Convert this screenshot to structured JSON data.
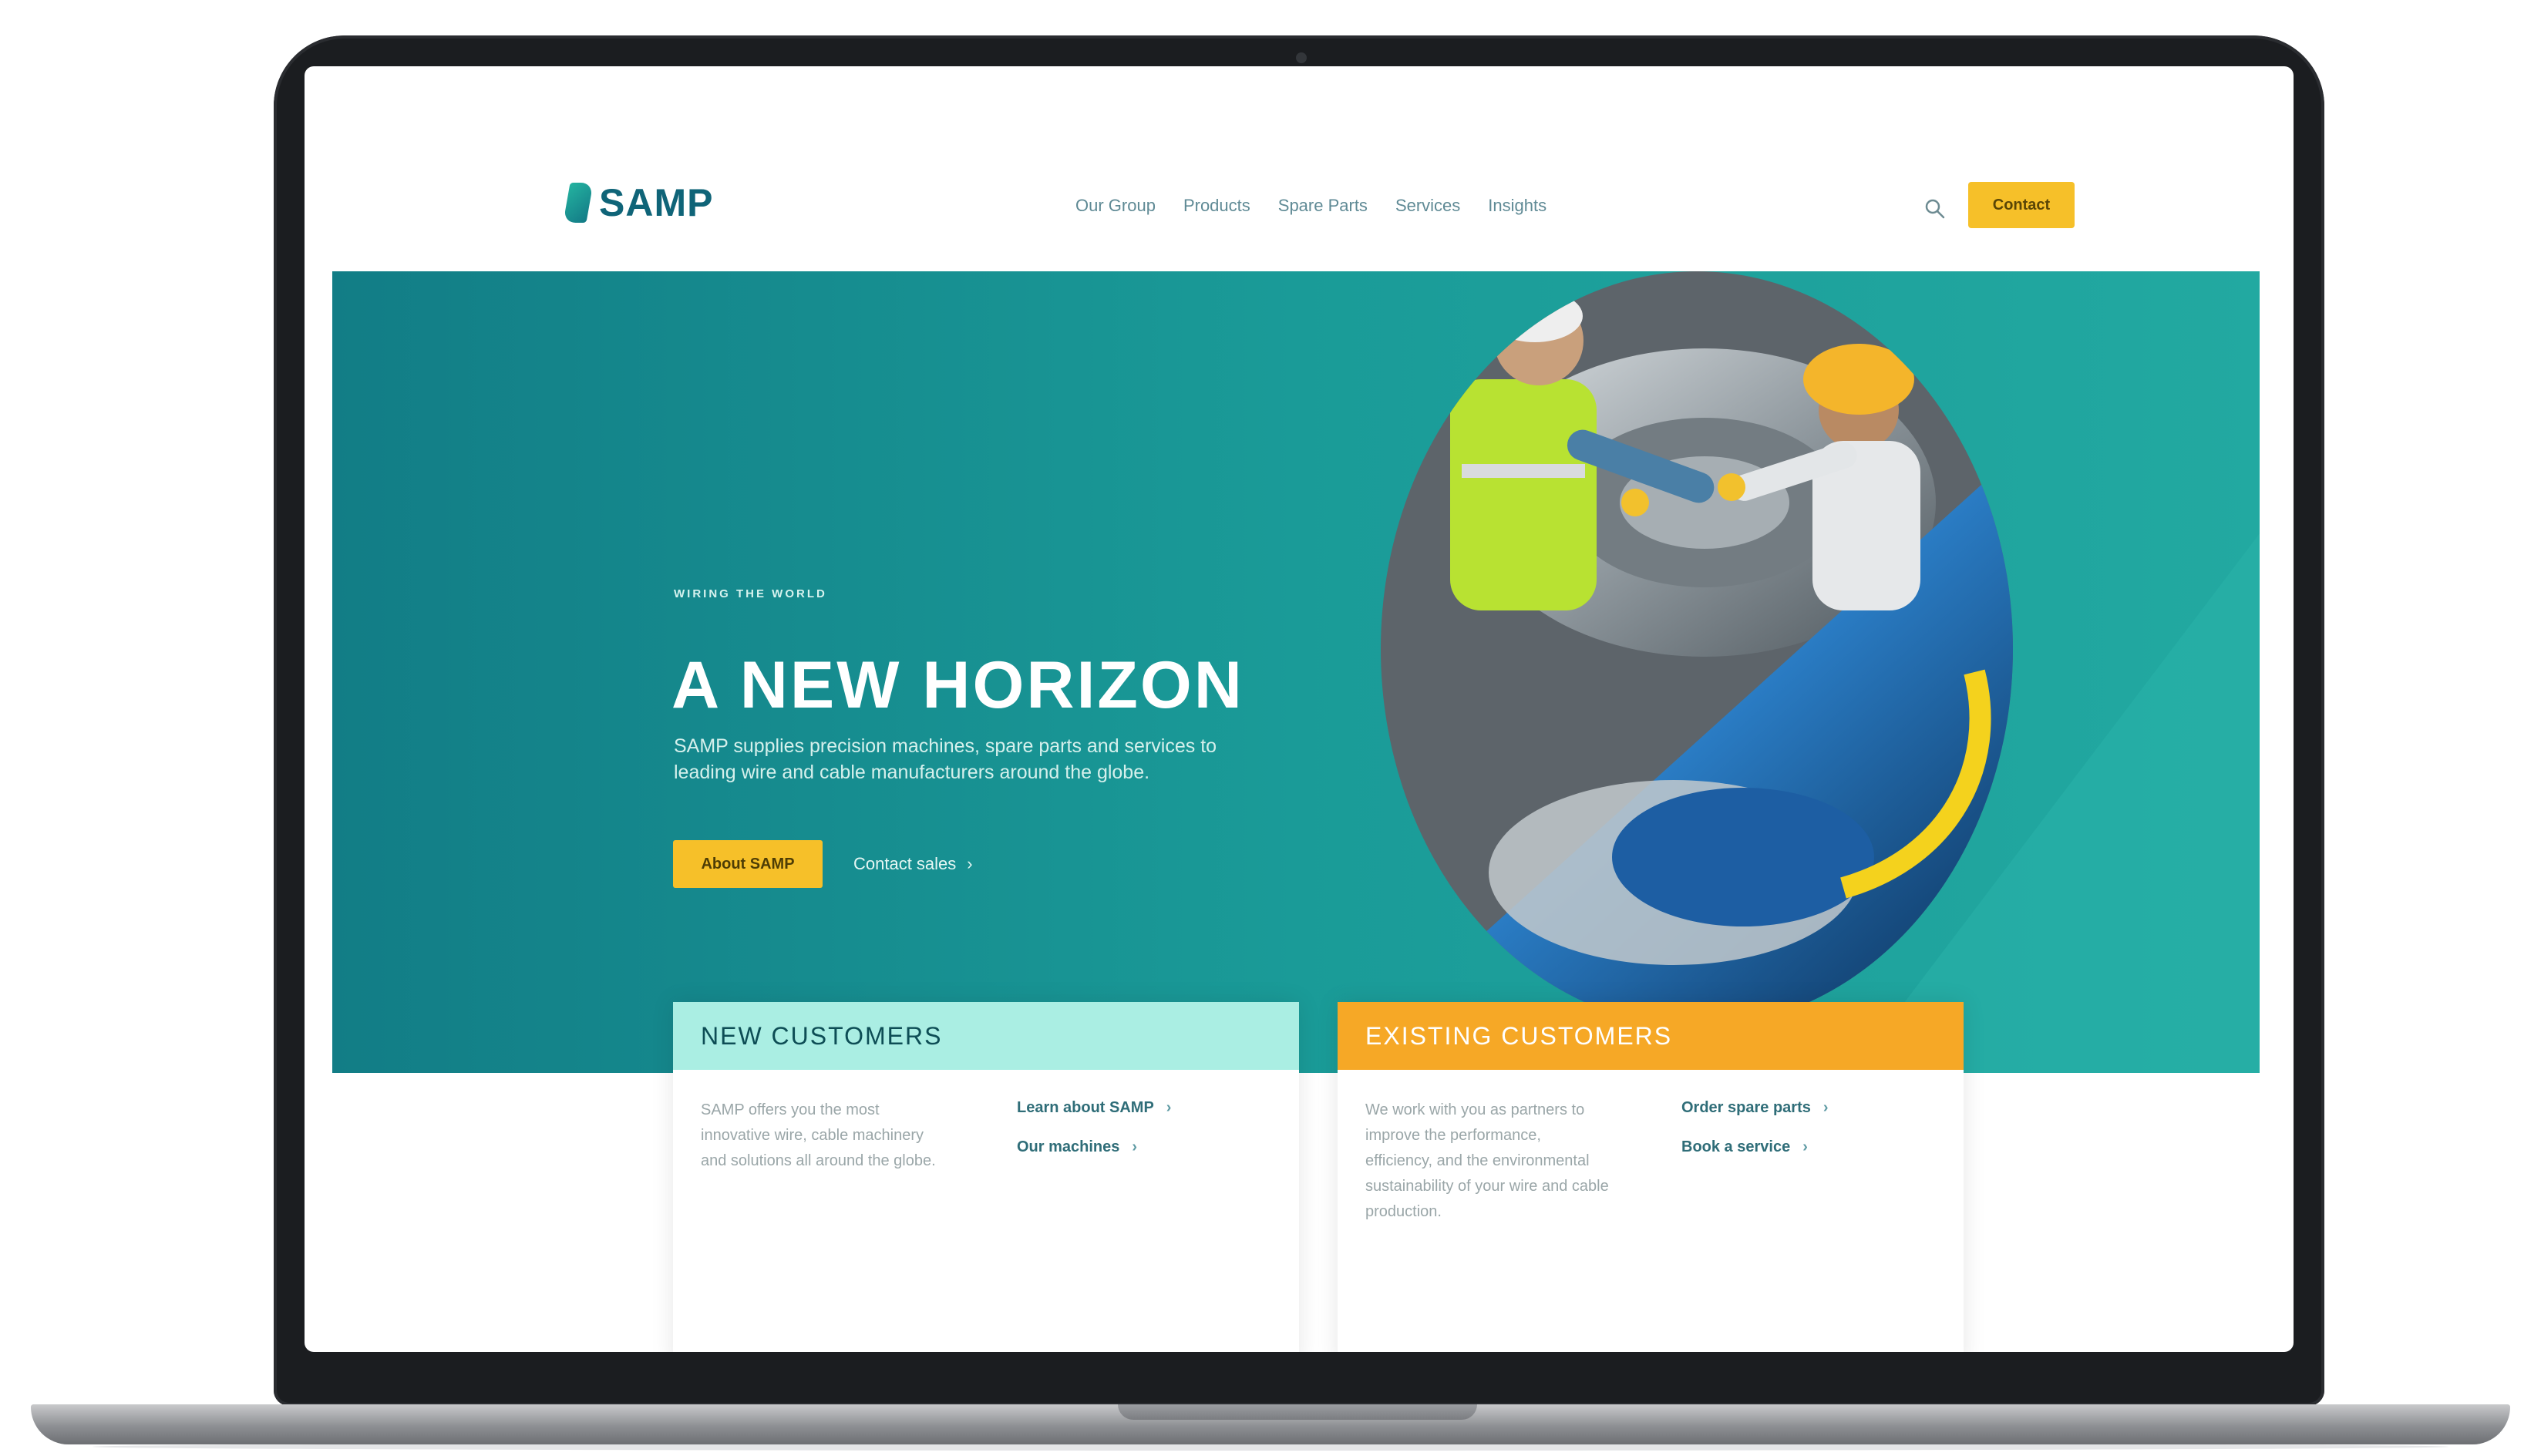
{
  "header": {
    "logo_text": "SAMP",
    "nav": [
      "Our Group",
      "Products",
      "Spare Parts",
      "Services",
      "Insights"
    ],
    "contact_label": "Contact"
  },
  "hero": {
    "eyebrow": "WIRING THE WORLD",
    "title": "A NEW HORIZON",
    "description": "SAMP supplies precision machines, spare parts and services to leading wire and cable manufacturers around the globe.",
    "primary_button": "About SAMP",
    "secondary_link": "Contact sales",
    "secondary_chevron": "›"
  },
  "cards": {
    "new": {
      "title": "NEW CUSTOMERS",
      "text": "SAMP offers you the most innovative wire, cable machinery and solutions all around the globe.",
      "links": [
        "Learn about SAMP",
        "Our machines"
      ]
    },
    "existing": {
      "title": "EXISTING CUSTOMERS",
      "text": "We work with you as partners to improve the performance, efficiency, and the environmental sustainability of your wire and cable production.",
      "links": [
        "Order spare parts",
        "Book a service"
      ]
    },
    "chevron": "›"
  },
  "colors": {
    "teal": "#1a9b98",
    "accent_yellow": "#f6c029",
    "mint": "#aaeee3",
    "orange": "#f6a826"
  },
  "icons": {
    "search": "search-icon",
    "logo_mark": "samp-logo-mark-icon"
  }
}
